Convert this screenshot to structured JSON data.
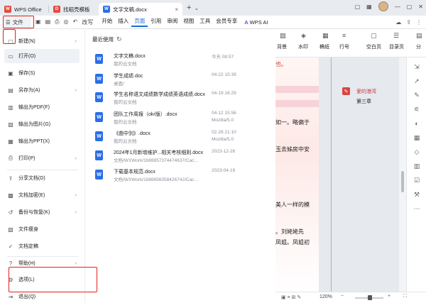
{
  "titlebar": {
    "tabs": [
      {
        "label": "WPS Office",
        "logo": "W",
        "color": "#e34b3c"
      },
      {
        "label": "找稻壳模板",
        "logo": "D",
        "color": "#e34b3c"
      },
      {
        "label": "文字文稿.docx",
        "logo": "W",
        "color": "#2a6ee8"
      }
    ],
    "close_glyph": "×",
    "new_tab": "+",
    "new_tab_chevron": "⌄"
  },
  "menubar": {
    "file_label": "文件",
    "redo_label": "改写",
    "items": [
      "开始",
      "插入",
      "页面",
      "引用",
      "审阅",
      "视图",
      "工具",
      "会员专享"
    ],
    "active_item": "页面",
    "wps_ai": "WPS AI"
  },
  "file_menu": {
    "items": [
      {
        "label": "新建(N)",
        "icon": "new-file-icon",
        "glyph": "▢",
        "arrow": true
      },
      {
        "label": "打开(O)",
        "icon": "folder-icon",
        "glyph": "▭",
        "arrow": false,
        "selected": true
      },
      {
        "label": "保存(S)",
        "icon": "save-icon",
        "glyph": "▣",
        "arrow": false
      },
      {
        "label": "另存为(A)",
        "icon": "save-as-icon",
        "glyph": "▤",
        "arrow": true
      },
      {
        "label": "输出为PDF(F)",
        "icon": "pdf-icon",
        "glyph": "▥",
        "arrow": false
      },
      {
        "label": "输出为图片(G)",
        "icon": "image-icon",
        "glyph": "▨",
        "arrow": false
      },
      {
        "label": "输出为PPT(X)",
        "icon": "ppt-icon",
        "glyph": "▦",
        "arrow": false
      },
      {
        "label": "打印(P)",
        "icon": "print-icon",
        "glyph": "⎙",
        "arrow": true
      },
      {
        "label": "分享文档(D)",
        "icon": "share-icon",
        "glyph": "⇪",
        "arrow": false
      },
      {
        "label": "文档加密(E)",
        "icon": "lock-icon",
        "glyph": "▩",
        "arrow": true
      },
      {
        "label": "备份与恢复(K)",
        "icon": "backup-icon",
        "glyph": "↺",
        "arrow": true
      },
      {
        "label": "文件瘦身",
        "icon": "compress-icon",
        "glyph": "▧",
        "arrow": false
      },
      {
        "label": "文档定稿",
        "icon": "finalize-icon",
        "glyph": "✓",
        "arrow": false
      },
      {
        "label": "帮助(H)",
        "icon": "help-icon",
        "glyph": "?",
        "arrow": true
      },
      {
        "label": "选项(L)",
        "icon": "gear-icon",
        "glyph": "⚙",
        "arrow": false
      },
      {
        "label": "退出(Q)",
        "icon": "exit-icon",
        "glyph": "⇥",
        "arrow": false
      }
    ],
    "arrow_glyph": "›"
  },
  "recent": {
    "title": "最近使用",
    "refresh_glyph": "↻",
    "file_icon_letter": "W",
    "files": [
      {
        "name": "文字文稿.docx",
        "path": "我的云文档",
        "time": "今天 08:57",
        "source": ""
      },
      {
        "name": "学生成绩.doc",
        "path": "桌面/",
        "time": "04-22 15:39",
        "source": ""
      },
      {
        "name": "学生名称语文成绩数学成绩英语成绩.docx",
        "path": "我的云文档",
        "time": "04-19 16:29",
        "source": ""
      },
      {
        "name": "团队工作周报（okr版）.docx",
        "path": "我的云文档",
        "time": "04-12 15:56",
        "source": "Mozilla/5.0"
      },
      {
        "name": "《曲中剑》.docx",
        "path": "我的云文档",
        "time": "02-28 21:10",
        "source": "Mozilla/5.0"
      },
      {
        "name": "2024年1月新增维护...相关考核细则.docx",
        "path": "文档/WXWork/1688857374474637/Cac...",
        "time": "2023-12-26",
        "source": ""
      },
      {
        "name": "下载基本规范.docx",
        "path": "文档/WXWork/1688856358426742/Cac...",
        "time": "2023-04-19",
        "source": ""
      }
    ]
  },
  "ribbon": {
    "items": [
      {
        "label": "背景",
        "icon": "background-icon",
        "glyph": "▨"
      },
      {
        "label": "水印",
        "icon": "watermark-icon",
        "glyph": "◈"
      },
      {
        "label": "稿纸",
        "icon": "paper-icon",
        "glyph": "▦"
      },
      {
        "label": "行号",
        "icon": "line-number-icon",
        "glyph": "≡"
      },
      {
        "label": "空白页",
        "icon": "blank-page-icon",
        "glyph": "▢"
      },
      {
        "label": "目录页",
        "icon": "toc-icon",
        "glyph": "☰"
      },
      {
        "label": "分",
        "icon": "section-icon",
        "glyph": "▤"
      }
    ],
    "chevron": "⌄"
  },
  "document": {
    "lines": [
      "如一。略偏于",
      "玉去姊房中安",
      "美人一样的模",
      "。刘姥姥先",
      "凤姐。凤姐初"
    ],
    "top_fragment": "也。"
  },
  "comment": {
    "user": "爱的港湾",
    "text": "第三章"
  },
  "statusbar": {
    "zoom": "120%"
  },
  "colors": {
    "accent": "#1a6bd8",
    "highlight": "#e02020",
    "comment": "#d94545"
  }
}
